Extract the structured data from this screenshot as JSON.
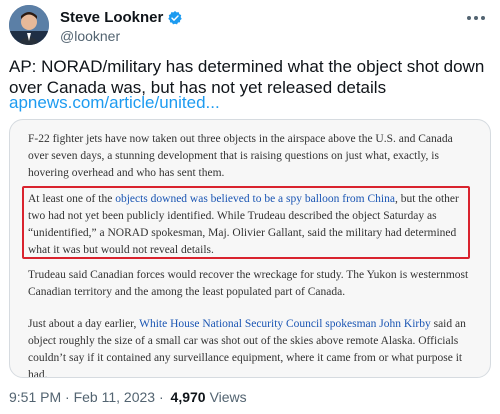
{
  "author": {
    "name": "Steve Lookner",
    "handle": "@lookner",
    "verified_icon": "verified-badge-icon",
    "colors": {
      "verified": "#1d9bf0"
    }
  },
  "tweet": {
    "text": "AP: NORAD/military has determined what the object shot down over Canada was, but has not yet released details",
    "link": "apnews.com/article/united...",
    "link_color": "#1d9bf0"
  },
  "article": {
    "p1": "F-22 fighter jets have now taken out three objects in the airspace above the U.S. and Canada over seven days, a stunning development that is raising questions on just what, exactly, is hovering overhead and who has sent them.",
    "p2_a": "At least one of the ",
    "p2_link": "objects downed was believed to be a spy balloon from China",
    "p2_b": ", but the other two had not yet been publicly identified. While Trudeau described the object Saturday as “unidentified,” a NORAD spokesman, Maj. Olivier Gallant, said the military had determined what it was but would not reveal details.",
    "p3": "Trudeau said Canadian forces would recover the wreckage for study. The Yukon is westernmost Canadian territory and the among the least populated part of Canada.",
    "p4_a": "Just about a day earlier, ",
    "p4_link": "White House National Security Council spokesman John Kirby",
    "p4_b": " said an object roughly the size of a small car was shot out of the skies above remote Alaska. Officials couldn’t say if it contained any surveillance equipment, where it came from or what purpose it had.",
    "highlight_color": "#d9232e"
  },
  "meta": {
    "time": "9:51 PM",
    "separator": " · ",
    "date": "Feb 11, 2023",
    "separator2": " · ",
    "views_count": "4,970",
    "views_label": "Views"
  }
}
